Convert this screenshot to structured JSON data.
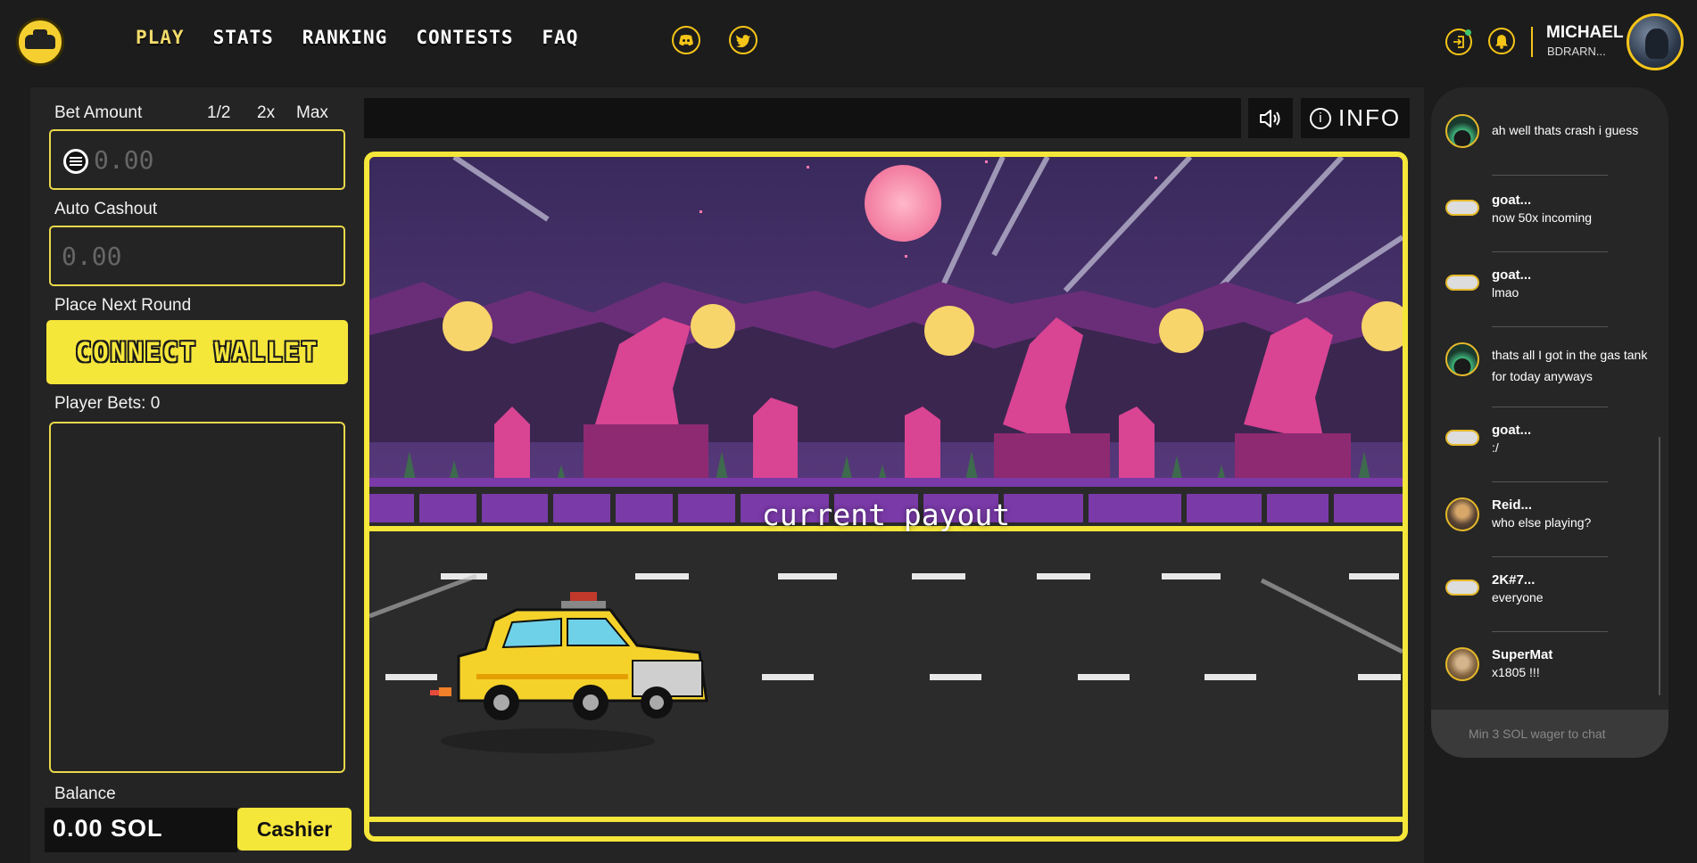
{
  "nav": {
    "items": [
      {
        "label": "PLAY",
        "active": true
      },
      {
        "label": "STATS",
        "active": false
      },
      {
        "label": "RANKING",
        "active": false
      },
      {
        "label": "CONTESTS",
        "active": false
      },
      {
        "label": "FAQ",
        "active": false
      }
    ],
    "social": [
      "discord-icon",
      "twitter-icon"
    ]
  },
  "user": {
    "name": "MICHAEL",
    "handle": "BDRARN...",
    "icons": [
      "login-icon",
      "bell-icon"
    ]
  },
  "left_panel": {
    "bet_amount_label": "Bet Amount",
    "quick_half": "1/2",
    "quick_double": "2x",
    "quick_max": "Max",
    "bet_placeholder": "0.00",
    "auto_cashout_label": "Auto Cashout",
    "auto_cashout_placeholder": "0.00",
    "place_next_round_label": "Place Next Round",
    "connect_wallet_label": "CONNECT WALLET",
    "player_bets_label": "Player Bets: 0",
    "balance_label": "Balance",
    "balance_value": "0.00 SOL",
    "cashier_label": "Cashier"
  },
  "game": {
    "info_label": "INFO",
    "payout_text": "current payout",
    "colors": {
      "frame": "#f5e63a",
      "accent": "#f5c518",
      "sky": "#3b2a5e",
      "rock": "#e0479c"
    }
  },
  "chat": {
    "messages": [
      {
        "author": "",
        "text": "ah well thats crash i guess",
        "avatar": "hood"
      },
      {
        "author": "goat...",
        "text": "now 50x incoming",
        "avatar": "pill"
      },
      {
        "author": "goat...",
        "text": "lmao",
        "avatar": "pill"
      },
      {
        "author": "",
        "text": "thats all I got in the gas tank for today anyways",
        "avatar": "hood"
      },
      {
        "author": "goat...",
        "text": ":/",
        "avatar": "pill"
      },
      {
        "author": "Reid...",
        "text": "who else playing?",
        "avatar": "person"
      },
      {
        "author": "2K#7...",
        "text": "everyone",
        "avatar": "pill"
      },
      {
        "author": "SuperMat",
        "text": "x1805 !!!",
        "avatar": "owl"
      }
    ],
    "input_placeholder": "Min 3 SOL wager to chat"
  }
}
